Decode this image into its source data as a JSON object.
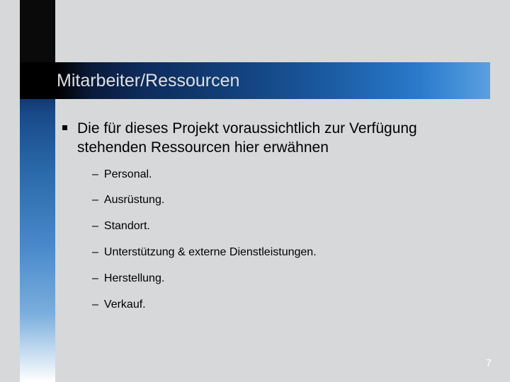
{
  "title": "Mitarbeiter/Ressourcen",
  "main_bullet": "Die für dieses Projekt voraussichtlich zur Verfügung stehenden Ressourcen hier erwähnen",
  "sub_items": [
    "Personal.",
    "Ausrüstung.",
    "Standort.",
    "Unterstützung & externe Dienstleistungen.",
    "Herstellung.",
    "Verkauf."
  ],
  "page_number": "7"
}
